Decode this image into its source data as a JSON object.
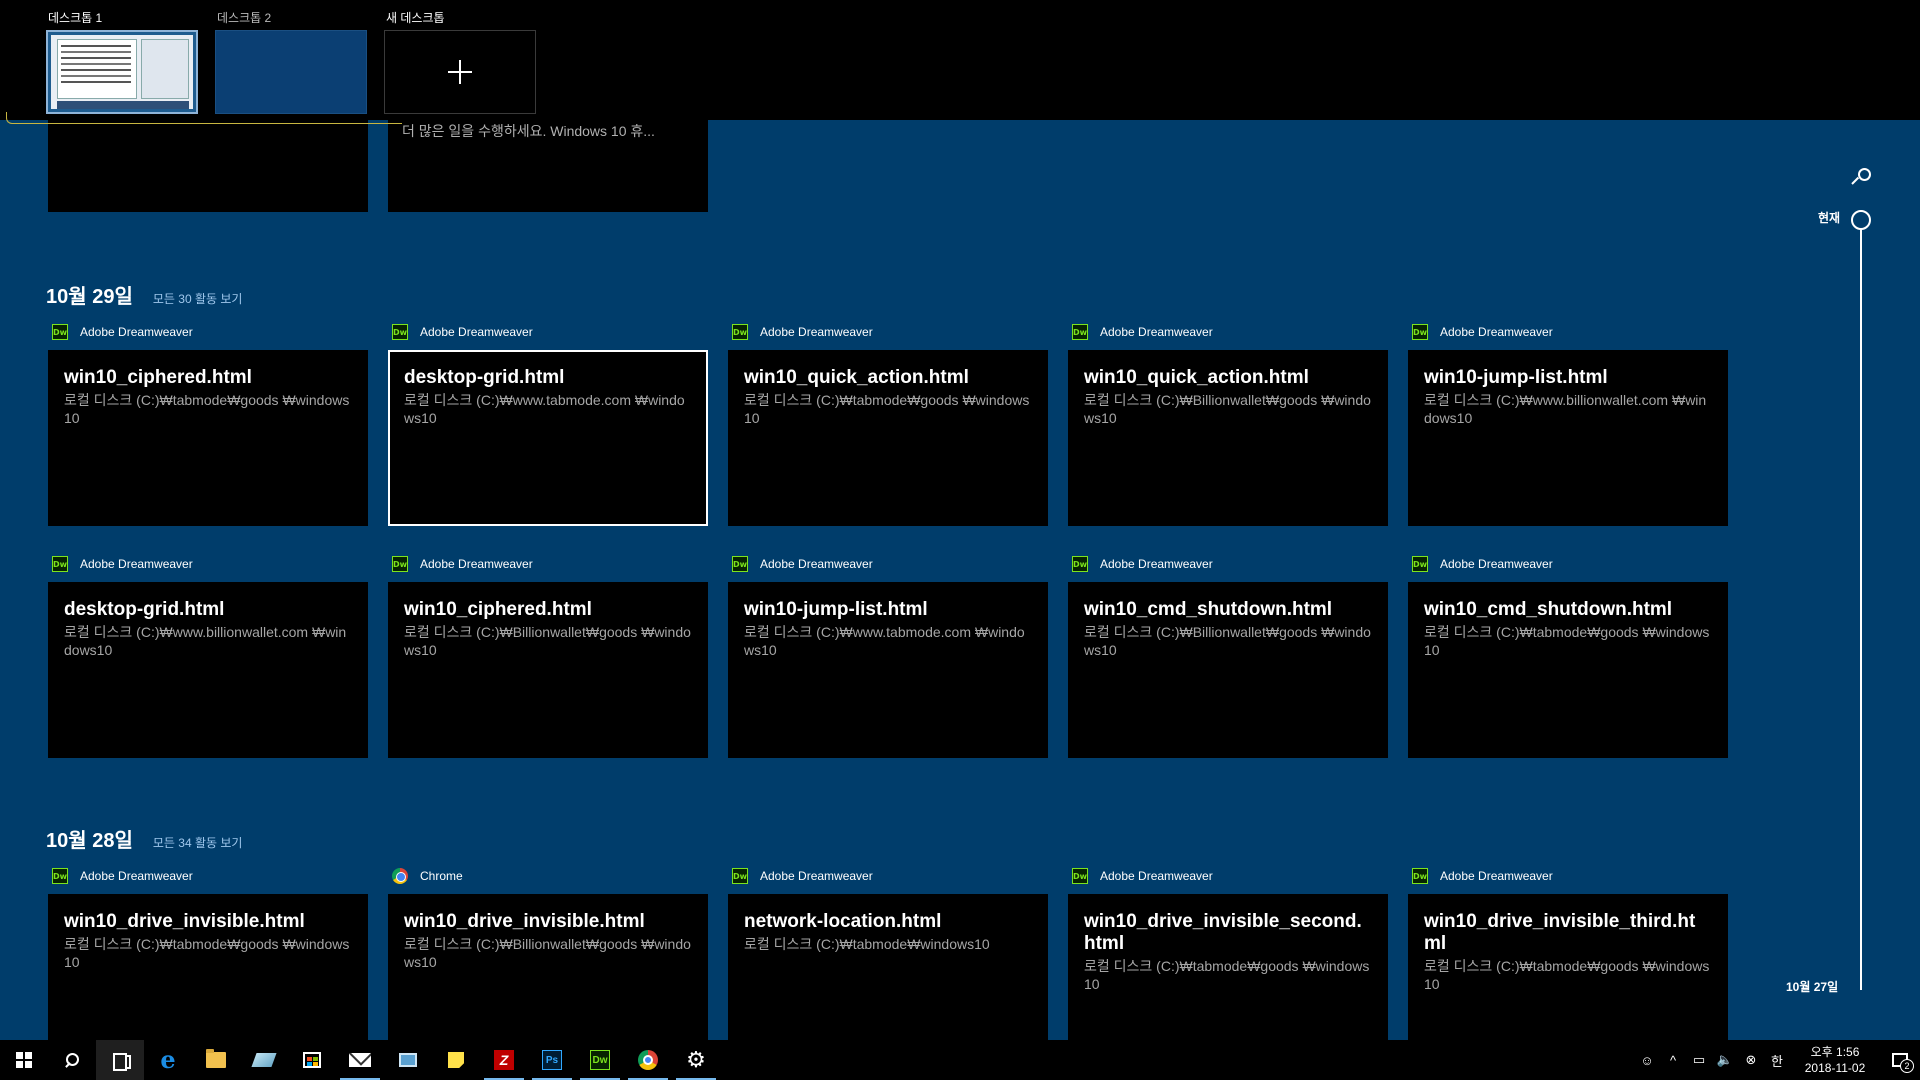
{
  "virtual_desktops": [
    {
      "label": "데스크톱 1",
      "active": true
    },
    {
      "label": "데스크톱 2",
      "active": false
    }
  ],
  "new_desktop_label": "새 데스크톱",
  "partial_previous_text": "더 많은 일을 수행하세요. Windows 10 휴...",
  "timeline": {
    "now_label": "현재",
    "bottom_label": "10월 27일"
  },
  "sections": [
    {
      "date": "10월 29일",
      "see_all": "모든 30 활동 보기",
      "cards": [
        {
          "app": "Adobe Dreamweaver",
          "app_icon": "dreamweaver-icon",
          "title": "win10_ciphered.html",
          "path": "로컬 디스크 (C:)₩tabmode₩goods ₩windows10"
        },
        {
          "app": "Adobe Dreamweaver",
          "app_icon": "dreamweaver-icon",
          "title": "desktop-grid.html",
          "path": "로컬 디스크 (C:)₩www.tabmode.com ₩windows10",
          "selected": true
        },
        {
          "app": "Adobe Dreamweaver",
          "app_icon": "dreamweaver-icon",
          "title": "win10_quick_action.html",
          "path": "로컬 디스크 (C:)₩tabmode₩goods ₩windows10"
        },
        {
          "app": "Adobe Dreamweaver",
          "app_icon": "dreamweaver-icon",
          "title": "win10_quick_action.html",
          "path": "로컬 디스크 (C:)₩Billionwallet₩goods ₩windows10"
        },
        {
          "app": "Adobe Dreamweaver",
          "app_icon": "dreamweaver-icon",
          "title": "win10-jump-list.html",
          "path": "로컬 디스크 (C:)₩www.billionwallet.com ₩windows10"
        },
        {
          "app": "Adobe Dreamweaver",
          "app_icon": "dreamweaver-icon",
          "title": "desktop-grid.html",
          "path": "로컬 디스크 (C:)₩www.billionwallet.com ₩windows10"
        },
        {
          "app": "Adobe Dreamweaver",
          "app_icon": "dreamweaver-icon",
          "title": "win10_ciphered.html",
          "path": "로컬 디스크 (C:)₩Billionwallet₩goods ₩windows10"
        },
        {
          "app": "Adobe Dreamweaver",
          "app_icon": "dreamweaver-icon",
          "title": "win10-jump-list.html",
          "path": "로컬 디스크 (C:)₩www.tabmode.com ₩windows10"
        },
        {
          "app": "Adobe Dreamweaver",
          "app_icon": "dreamweaver-icon",
          "title": "win10_cmd_shutdown.html",
          "path": "로컬 디스크 (C:)₩Billionwallet₩goods ₩windows10"
        },
        {
          "app": "Adobe Dreamweaver",
          "app_icon": "dreamweaver-icon",
          "title": "win10_cmd_shutdown.html",
          "path": "로컬 디스크 (C:)₩tabmode₩goods ₩windows10"
        }
      ]
    },
    {
      "date": "10월 28일",
      "see_all": "모든 34 활동 보기",
      "cards": [
        {
          "app": "Adobe Dreamweaver",
          "app_icon": "dreamweaver-icon",
          "title": "win10_drive_invisible.html",
          "path": "로컬 디스크 (C:)₩tabmode₩goods ₩windows10"
        },
        {
          "app": "Chrome",
          "app_icon": "chrome-icon",
          "title": "win10_drive_invisible.html",
          "path": "로컬 디스크 (C:)₩Billionwallet₩goods ₩windows10"
        },
        {
          "app": "Adobe Dreamweaver",
          "app_icon": "dreamweaver-icon",
          "title": "network-location.html",
          "path": "로컬 디스크 (C:)₩tabmode₩windows10"
        },
        {
          "app": "Adobe Dreamweaver",
          "app_icon": "dreamweaver-icon",
          "title": "win10_drive_invisible_second.html",
          "path": "로컬 디스크 (C:)₩tabmode₩goods ₩windows10"
        },
        {
          "app": "Adobe Dreamweaver",
          "app_icon": "dreamweaver-icon",
          "title": "win10_drive_invisible_third.html",
          "path": "로컬 디스크 (C:)₩tabmode₩goods ₩windows10"
        }
      ]
    }
  ],
  "taskbar": {
    "pinned": [
      "windows-start-icon",
      "search-icon",
      "task-view-icon",
      "edge-icon",
      "file-explorer-icon",
      "eraser-app-icon",
      "store-icon",
      "mail-icon",
      "news-icon",
      "sticky-notes-icon",
      "filezilla-icon",
      "photoshop-icon",
      "dreamweaver-icon",
      "chrome-icon",
      "settings-gear-icon"
    ],
    "filezilla_label": "Z",
    "photoshop_label": "Ps",
    "dreamweaver_label": "Dw",
    "clock_period_time": "오후 1:56",
    "clock_date": "2018-11-02",
    "ime_label": "한",
    "notification_count": "2"
  },
  "dw_icon_text": "Dw"
}
